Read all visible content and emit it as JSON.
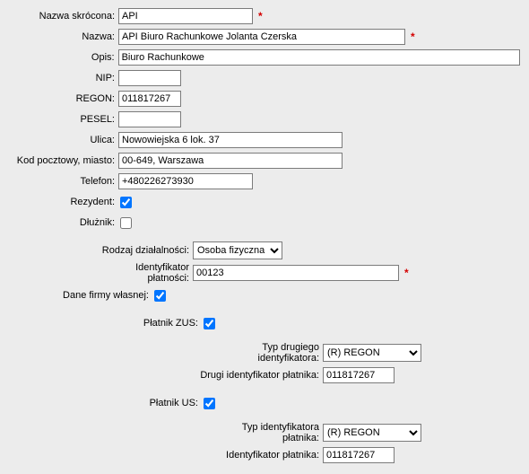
{
  "labels": {
    "shortName": "Nazwa skrócona:",
    "name": "Nazwa:",
    "desc": "Opis:",
    "nip": "NIP:",
    "regon": "REGON:",
    "pesel": "PESEL:",
    "street": "Ulica:",
    "postalCity": "Kod pocztowy, miasto:",
    "phone": "Telefon:",
    "resident": "Rezydent:",
    "debtor": "Dłużnik:",
    "activityType": "Rodzaj działalności:",
    "paymentId": "Identyfikator płatności:",
    "ownCompany": "Dane firmy własnej:",
    "zusPayer": "Płatnik ZUS:",
    "secondIdType": "Typ drugiego identyfikatora:",
    "secondPayerId": "Drugi identyfikator płatnika:",
    "usPayer": "Płatnik US:",
    "payerIdType": "Typ identyfikatora płatnika:",
    "payerId": "Identyfikator płatnika:"
  },
  "values": {
    "shortName": "API",
    "name": "API Biuro Rachunkowe Jolanta Czerska",
    "desc": "Biuro Rachunkowe",
    "nip": "",
    "regon": "011817267",
    "pesel": "",
    "street": "Nowowiejska 6 lok. 37",
    "postalCity": "00-649, Warszawa",
    "phone": "+480226273930",
    "activityType": "Osoba fizyczna",
    "paymentId": "00123",
    "secondIdType": "(R) REGON",
    "secondPayerId": "011817267",
    "payerIdType": "(R) REGON",
    "payerId": "011817267"
  },
  "required": "*"
}
